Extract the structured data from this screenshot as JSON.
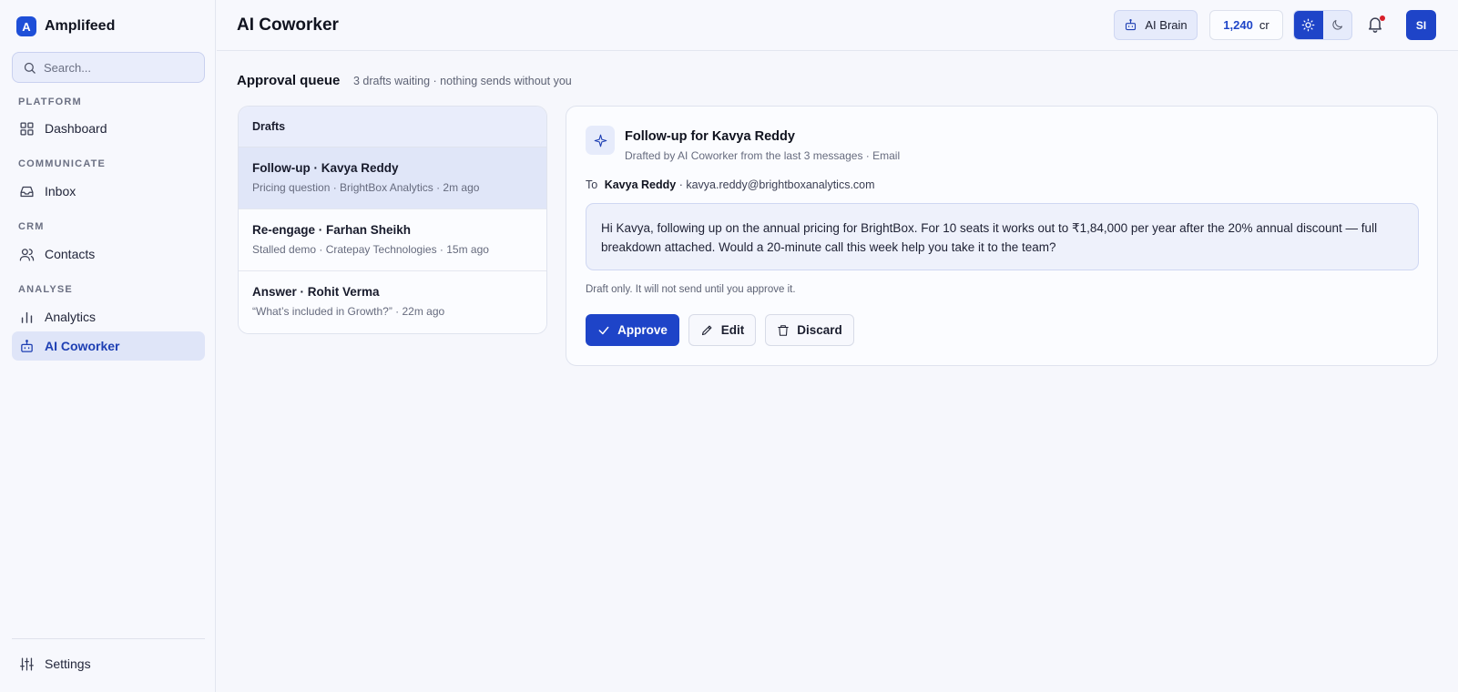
{
  "brand": {
    "logo_letter": "A",
    "name": "Amplifeed"
  },
  "search": {
    "placeholder": "Search..."
  },
  "sidebar": {
    "sections": [
      {
        "label": "PLATFORM"
      },
      {
        "label": "COMMUNICATE"
      },
      {
        "label": "CRM"
      },
      {
        "label": "ANALYSE"
      }
    ],
    "items": [
      {
        "label": "Dashboard",
        "icon": "grid-icon"
      },
      {
        "label": "Inbox",
        "icon": "inbox-icon"
      },
      {
        "label": "Contacts",
        "icon": "users-icon"
      },
      {
        "label": "Analytics",
        "icon": "bar-chart-icon"
      },
      {
        "label": "AI Coworker",
        "icon": "bot-icon",
        "active": true
      }
    ],
    "settings_label": "Settings"
  },
  "header": {
    "title": "AI Coworker",
    "ai_brain_label": "AI Brain",
    "credits_value": "1,240",
    "credits_unit": "cr",
    "avatar_initials": "SI",
    "notification_dot_color": "#d8202a"
  },
  "queue": {
    "title": "Approval queue",
    "subtitle": "3 drafts waiting · nothing sends without you"
  },
  "drafts": {
    "header": "Drafts",
    "items": [
      {
        "title": "Follow-up · Kavya Reddy",
        "meta": "Pricing question · BrightBox Analytics · 2m ago",
        "selected": true
      },
      {
        "title": "Re-engage · Farhan Sheikh",
        "meta": "Stalled demo · Cratepay Technologies · 15m ago"
      },
      {
        "title": "Answer · Rohit Verma",
        "meta": "“What’s included in Growth?” · 22m ago"
      }
    ]
  },
  "detail": {
    "title": "Follow-up for Kavya Reddy",
    "subtitle": "Drafted by AI Coworker from the last 3 messages · Email",
    "to_prefix": "To",
    "to_name": "Kavya Reddy",
    "to_email": "· kavya.reddy@brightboxanalytics.com",
    "message": "Hi Kavya, following up on the annual pricing for BrightBox. For 10 seats it works out to ₹1,84,000 per year after the 20% annual discount — full breakdown attached. Would a 20-minute call this week help you take it to the team?",
    "note": "Draft only. It will not send until you approve it.",
    "approve_label": "Approve",
    "edit_label": "Edit",
    "discard_label": "Discard"
  },
  "colors": {
    "accent": "#1e44c8",
    "active_nav_bg": "#dfe5f8"
  }
}
